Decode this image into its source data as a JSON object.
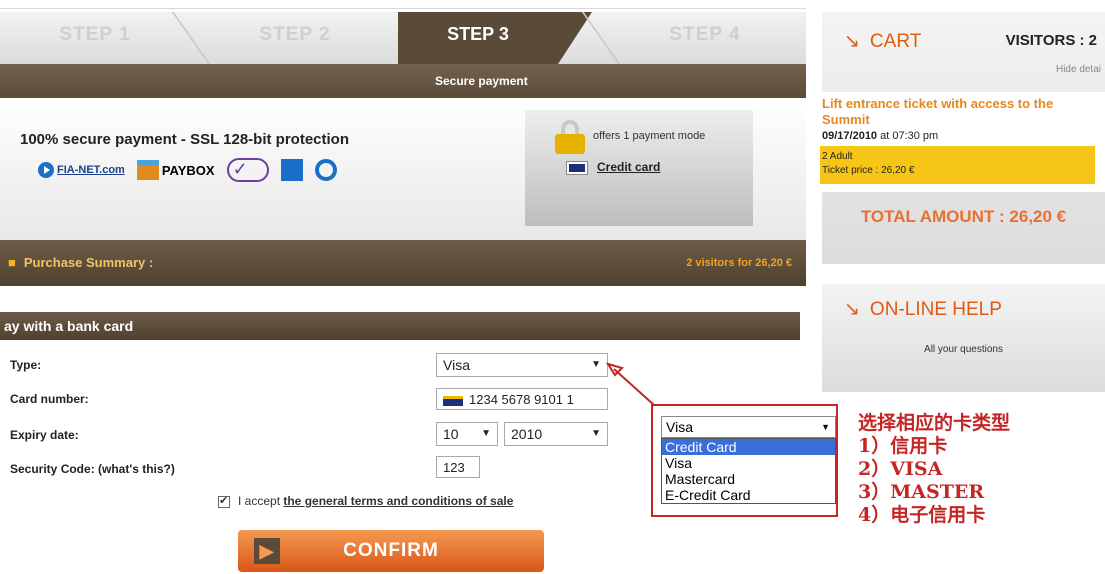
{
  "steps": {
    "s1": "STEP 1",
    "s2": "STEP 2",
    "s3": "STEP 3",
    "s4": "STEP 4",
    "subtitle": "Secure payment"
  },
  "secure": {
    "title": "100% secure payment - SSL 128-bit protection",
    "logo_fianet": "FIA-NET.com",
    "logo_paybox": "PAYBOX"
  },
  "paymode": {
    "offers": "offers 1 payment mode",
    "credit_card": "Credit card"
  },
  "summary": {
    "label": "Purchase Summary :",
    "value": "2 visitors for 26,20 €"
  },
  "pay": {
    "title": "ay with a bank card",
    "type_label": "Type:",
    "type_value": "Visa",
    "card_label": "Card number:",
    "card_value": "1234 5678 9101 1",
    "expiry_label": "Expiry date:",
    "expiry_month": "10",
    "expiry_year": "2010",
    "cvv_label": "Security Code: (what's this?)",
    "cvv_value": "123",
    "accept_text": "I accept ",
    "accept_link": "the general terms and conditions of sale",
    "confirm": "CONFIRM"
  },
  "dropdown": {
    "selected": "Visa",
    "options": [
      "Credit Card",
      "Visa",
      "Mastercard",
      "E-Credit Card"
    ]
  },
  "annotation": {
    "l1": "选择相应的卡类型",
    "l2": "1）信用卡",
    "l3": "2）VISA",
    "l4": "3）MASTER",
    "l5": "4）电子信用卡"
  },
  "cart": {
    "title": "CART",
    "visitors": "VISITORS : 2",
    "hide": "Hide detai",
    "item": "Lift entrance ticket with access to the Summit",
    "date": "09/17/2010",
    "time": " at 07:30 pm",
    "adult": "2 Adult",
    "price": "Ticket price :  26,20  €",
    "total": "TOTAL AMOUNT : 26,20 €"
  },
  "help": {
    "title": "ON-LINE HELP",
    "text": "All your questions"
  },
  "colors": {
    "brown": "#5a4a38",
    "orange": "#e05a10",
    "red": "#c42525",
    "yellow": "#f5c518"
  }
}
